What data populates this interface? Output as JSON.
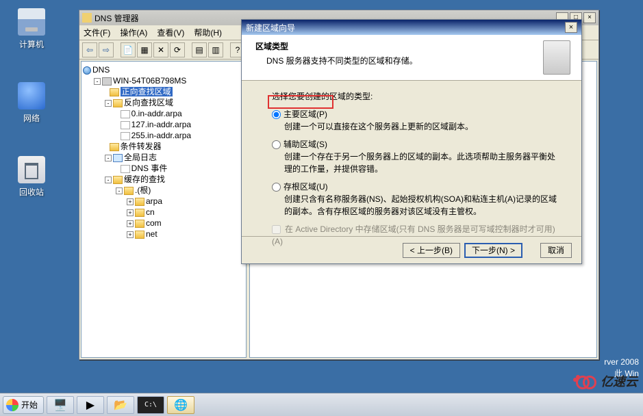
{
  "desktop": {
    "computer": "计算机",
    "network": "网络",
    "recycle": "回收站"
  },
  "dns_window": {
    "title": "DNS 管理器",
    "menu": {
      "file": "文件(F)",
      "action": "操作(A)",
      "view": "查看(V)",
      "help": "帮助(H)"
    },
    "tree": {
      "root": "DNS",
      "server": "WIN-54T06B798MS",
      "fwd_zone": "正向查找区域",
      "rev_zone": "反向查找区域",
      "rev1": "0.in-addr.arpa",
      "rev2": "127.in-addr.arpa",
      "rev3": "255.in-addr.arpa",
      "cond_fwd": "条件转发器",
      "global_log": "全局日志",
      "dns_event": "DNS 事件",
      "cached": "缓存的查找",
      "root_folder": ".(根)",
      "arpa": "arpa",
      "cn": "cn",
      "com": "com",
      "net": "net"
    }
  },
  "wizard": {
    "title": "新建区域向导",
    "header": "区域类型",
    "header_sub": "DNS 服务器支持不同类型的区域和存储。",
    "prompt": "选择您要创建的区域的类型:",
    "opt1": "主要区域(P)",
    "opt1_desc": "创建一个可以直接在这个服务器上更新的区域副本。",
    "opt2": "辅助区域(S)",
    "opt2_desc": "创建一个存在于另一个服务器上的区域的副本。此选项帮助主服务器平衡处理的工作量，并提供容错。",
    "opt3": "存根区域(U)",
    "opt3_desc": "创建只含有名称服务器(NS)、起始授权机构(SOA)和粘连主机(A)记录的区域的副本。含有存根区域的服务器对该区域没有主管权。",
    "chk": "在 Active Directory 中存储区域(只有 DNS 服务器是可写域控制器时才可用)(A)",
    "back": "< 上一步(B)",
    "next": "下一步(N) >",
    "cancel": "取消"
  },
  "taskbar": {
    "start": "开始"
  },
  "status": {
    "line1": "rver 2008",
    "line2": "此 Win"
  },
  "logo": "亿速云"
}
